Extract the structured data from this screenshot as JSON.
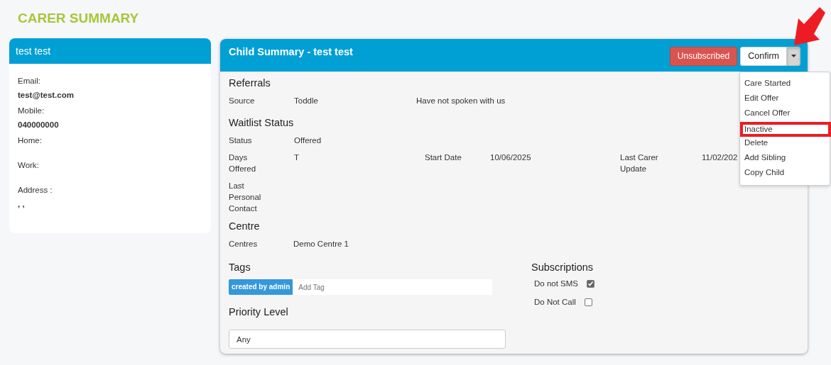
{
  "page_title": "CARER SUMMARY",
  "carer": {
    "name": "test test",
    "fields": [
      {
        "label": "Email:",
        "value": "test@test.com"
      },
      {
        "label": "Mobile:",
        "value": "040000000"
      },
      {
        "label": "Home:"
      },
      {
        "label": "Work:"
      },
      {
        "label": "Address :",
        "value": ", ,"
      }
    ]
  },
  "child": {
    "title": "Child Summary - test test",
    "status_button": "Unsubscribed",
    "action_button": "Confirm",
    "menu": {
      "expanded": true,
      "items": [
        {
          "label": "Care Started",
          "highlighted": false
        },
        {
          "label": "Edit Offer",
          "highlighted": false
        },
        {
          "label": "Cancel Offer",
          "highlighted": false
        },
        {
          "label": "Inactive",
          "highlighted": true
        },
        {
          "label": "Delete",
          "highlighted": false
        },
        {
          "label": "Add Sibling",
          "highlighted": false
        },
        {
          "label": "Copy Child",
          "highlighted": false
        }
      ]
    },
    "referrals": {
      "heading": "Referrals",
      "label": "Source",
      "value": "Toddle",
      "note": "Have not spoken with us"
    },
    "waitlist": {
      "heading": "Waitlist Status",
      "rows": [
        [
          {
            "label": "Status",
            "value": "Offered"
          }
        ],
        [
          {
            "label": "Days Offered",
            "value": "T"
          },
          {
            "label": "Start Date",
            "value": "10/06/2025"
          },
          {
            "label": "Last Carer Update",
            "value": "11/02/202"
          }
        ],
        [
          {
            "label": "Last Personal Contact"
          }
        ]
      ]
    },
    "centre": {
      "heading": "Centre",
      "label": "Centres",
      "value": "Demo Centre 1"
    },
    "tags": {
      "heading": "Tags",
      "items": [
        "created by admin"
      ],
      "placeholder": "Add Tag"
    },
    "priority": {
      "heading": "Priority Level",
      "value": "Any"
    },
    "subscriptions": {
      "heading": "Subscriptions",
      "items": [
        {
          "label": "Do not SMS",
          "checked": true
        },
        {
          "label": "Do Not Call",
          "checked": false
        }
      ]
    }
  }
}
